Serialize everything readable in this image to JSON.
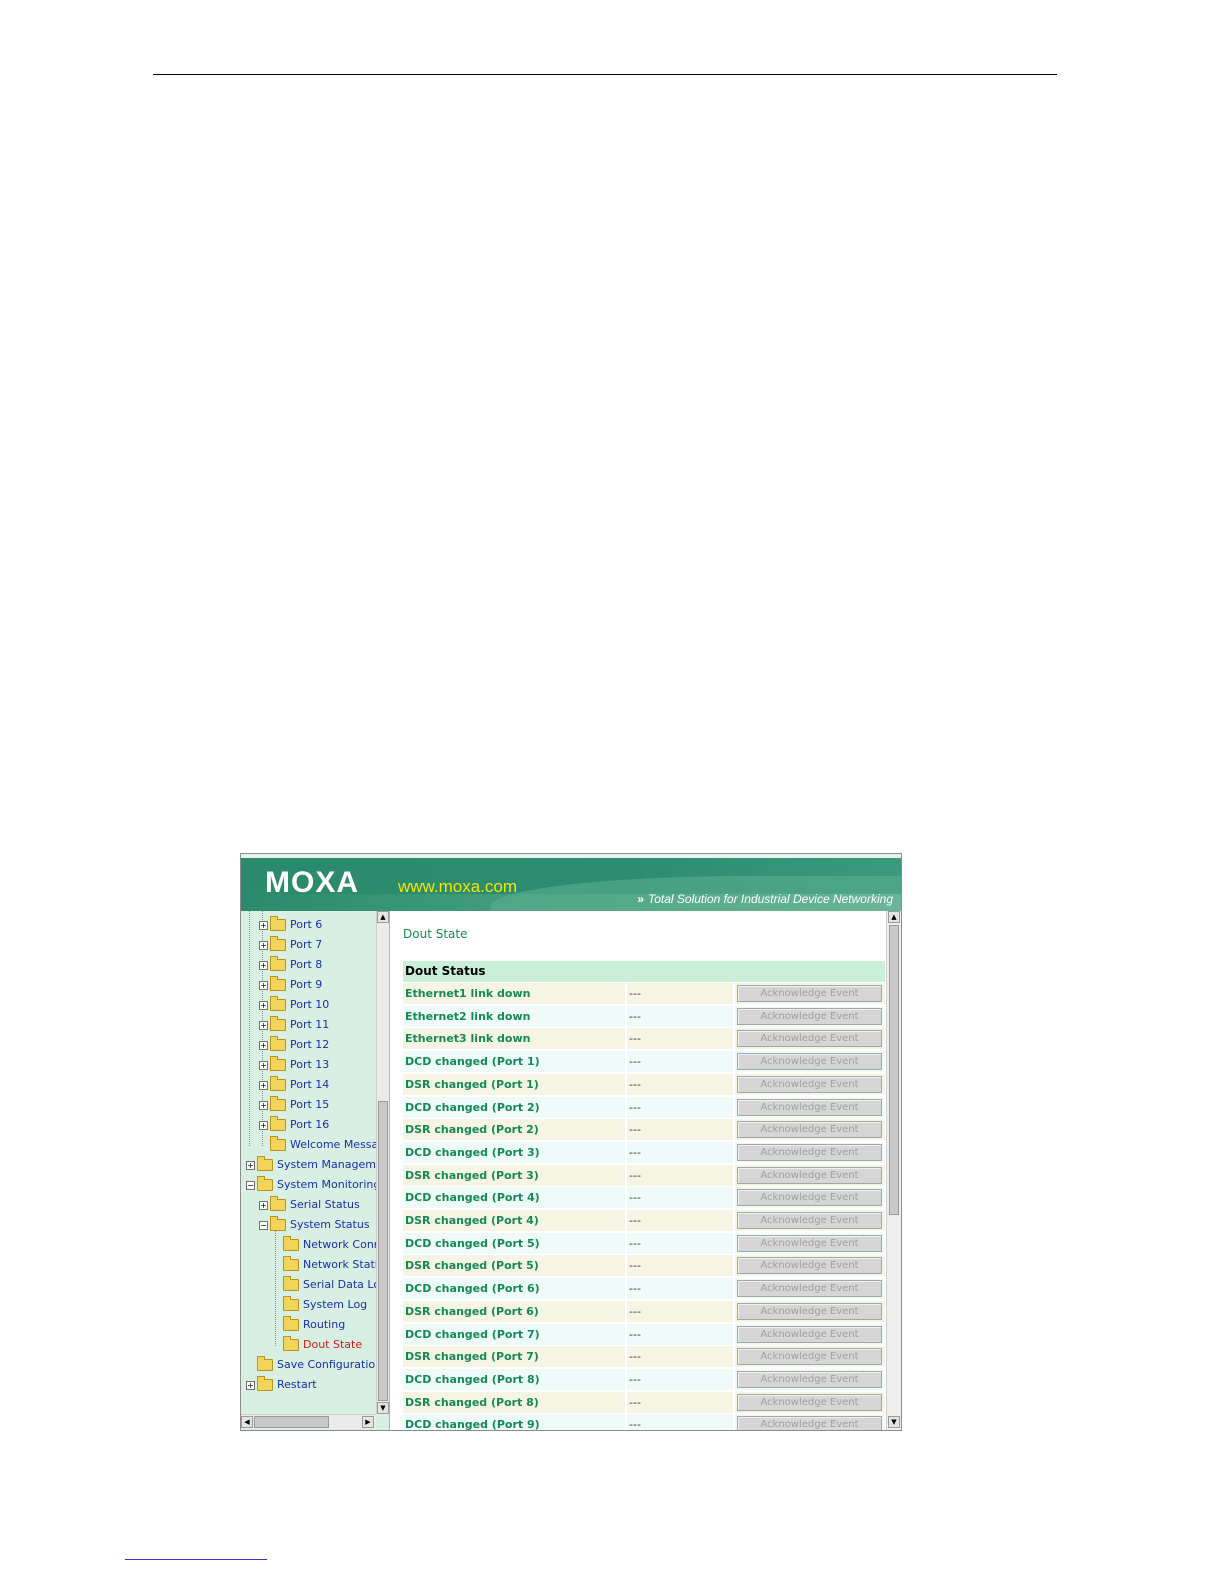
{
  "banner": {
    "logo": "MOXA",
    "url": "www.moxa.com",
    "tagline": "Total Solution for Industrial Device Networking",
    "tagline_arrows": "»"
  },
  "colors": {
    "banner_green": "#2e8b6e",
    "url_yellow": "#f5e600",
    "tree_bg": "#d8f0e4",
    "tree_link": "#1a2ea8",
    "tree_current": "#d21a1a",
    "label_green": "#148a57",
    "section_header_bg": "#c9efd9"
  },
  "tree": {
    "items": [
      {
        "label": "Port 6",
        "expander": "+"
      },
      {
        "label": "Port 7",
        "expander": "+"
      },
      {
        "label": "Port 8",
        "expander": "+"
      },
      {
        "label": "Port 9",
        "expander": "+"
      },
      {
        "label": "Port 10",
        "expander": "+"
      },
      {
        "label": "Port 11",
        "expander": "+"
      },
      {
        "label": "Port 12",
        "expander": "+"
      },
      {
        "label": "Port 13",
        "expander": "+"
      },
      {
        "label": "Port 14",
        "expander": "+"
      },
      {
        "label": "Port 15",
        "expander": "+"
      },
      {
        "label": "Port 16",
        "expander": "+"
      },
      {
        "label": "Welcome Messag",
        "expander": ""
      },
      {
        "label": "System Managemen",
        "expander": "+"
      },
      {
        "label": "System Monitoring",
        "expander": "−"
      },
      {
        "label": "Serial Status",
        "expander": "+"
      },
      {
        "label": "System Status",
        "expander": "−"
      },
      {
        "label": "Network Conne",
        "expander": ""
      },
      {
        "label": "Network Statis",
        "expander": ""
      },
      {
        "label": "Serial Data Log",
        "expander": ""
      },
      {
        "label": "System Log",
        "expander": ""
      },
      {
        "label": "Routing",
        "expander": ""
      },
      {
        "label": "Dout State",
        "expander": ""
      },
      {
        "label": "Save Configuration",
        "expander": ""
      },
      {
        "label": "Restart",
        "expander": "+"
      }
    ]
  },
  "content": {
    "title": "Dout State",
    "section_header": "Dout Status",
    "button_label": "Acknowledge Event",
    "rows": [
      {
        "label": "Ethernet1 link down",
        "value": "---"
      },
      {
        "label": "Ethernet2 link down",
        "value": "---"
      },
      {
        "label": "Ethernet3 link down",
        "value": "---"
      },
      {
        "label": "DCD changed (Port 1)",
        "value": "---"
      },
      {
        "label": "DSR changed (Port 1)",
        "value": "---"
      },
      {
        "label": "DCD changed (Port 2)",
        "value": "---"
      },
      {
        "label": "DSR changed (Port 2)",
        "value": "---"
      },
      {
        "label": "DCD changed (Port 3)",
        "value": "---"
      },
      {
        "label": "DSR changed (Port 3)",
        "value": "---"
      },
      {
        "label": "DCD changed (Port 4)",
        "value": "---"
      },
      {
        "label": "DSR changed (Port 4)",
        "value": "---"
      },
      {
        "label": "DCD changed (Port 5)",
        "value": "---"
      },
      {
        "label": "DSR changed (Port 5)",
        "value": "---"
      },
      {
        "label": "DCD changed (Port 6)",
        "value": "---"
      },
      {
        "label": "DSR changed (Port 6)",
        "value": "---"
      },
      {
        "label": "DCD changed (Port 7)",
        "value": "---"
      },
      {
        "label": "DSR changed (Port 7)",
        "value": "---"
      },
      {
        "label": "DCD changed (Port 8)",
        "value": "---"
      },
      {
        "label": "DSR changed (Port 8)",
        "value": "---"
      },
      {
        "label": "DCD changed (Port 9)",
        "value": "---"
      }
    ]
  }
}
